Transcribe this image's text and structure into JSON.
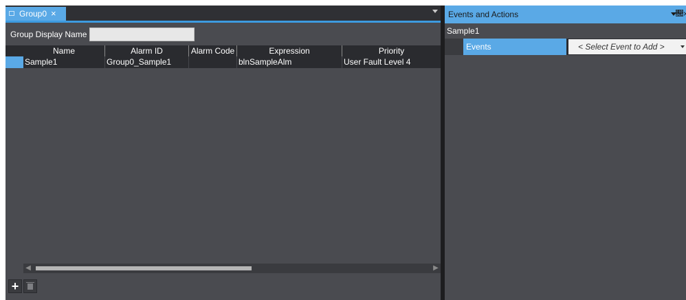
{
  "document_tab": {
    "title": "Group0",
    "close": "×"
  },
  "group_display_name": {
    "label": "Group Display Name",
    "value": ""
  },
  "table": {
    "columns": [
      "Name",
      "Alarm ID",
      "Alarm Code",
      "Expression",
      "Priority"
    ],
    "rows": [
      {
        "name": "Sample1",
        "alarm_id": "Group0_Sample1",
        "alarm_code": "",
        "expression": "blnSampleAlm",
        "priority": "User Fault Level 4"
      }
    ]
  },
  "toolbar": {
    "add_label": "+"
  },
  "events_panel": {
    "title": "Events and Actions",
    "subtitle": "Sample1",
    "events_label": "Events",
    "select_event": "< Select Event to Add >",
    "pin": "ᵖ",
    "close": "×"
  },
  "colors": {
    "accent": "#5aa9e6",
    "panel": "#4a4b50",
    "grid_row": "#2a2b2f"
  }
}
